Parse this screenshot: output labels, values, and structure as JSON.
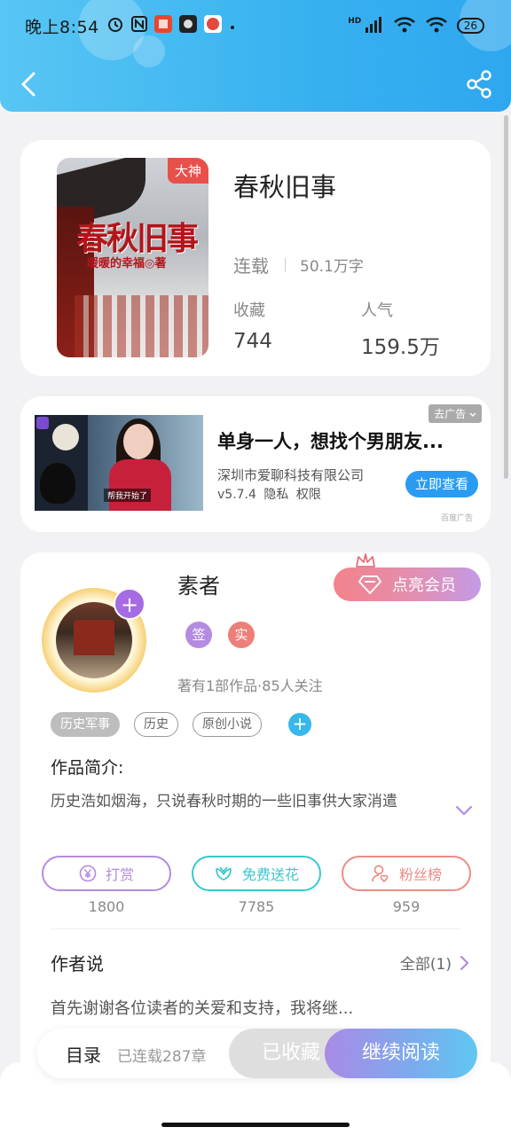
{
  "status_bar": {
    "time": "晚上8:54",
    "network": "HD",
    "battery": "26"
  },
  "book": {
    "title": "春秋旧事",
    "cover_title": "春秋旧事",
    "cover_author": "暖暖的幸福◎著",
    "badge": "大神",
    "status": "连载",
    "word_count": "50.1万字",
    "favorites_label": "收藏",
    "favorites_value": "744",
    "popularity_label": "人气",
    "popularity_value": "159.5万"
  },
  "ad": {
    "close_label": "去广告",
    "image_caption": "帮我开始了",
    "headline": "单身一人，想找个男朋友...",
    "company": "深圳市爱聊科技有限公司",
    "version": "v5.7.4",
    "privacy": "隐私",
    "permission": "权限",
    "cta": "立即查看",
    "source": "百度广告"
  },
  "author": {
    "name": "素者",
    "vip_button": "点亮会员",
    "chip_sign": "签",
    "chip_real": "实",
    "info": "著有1部作品·85人关注",
    "tags": [
      "历史军事",
      "历史",
      "原创小说"
    ],
    "intro_heading": "作品简介:",
    "intro_text": "历史浩如烟海，只说春秋时期的一些旧事供大家消遣",
    "actions": [
      {
        "label": "打赏",
        "count": "1800",
        "color": "#b48be0"
      },
      {
        "label": "免费送花",
        "count": "7785",
        "color": "#3cc7cf"
      },
      {
        "label": "粉丝榜",
        "count": "959",
        "color": "#ec8c86"
      }
    ],
    "talk_heading": "作者说",
    "talk_all": "全部(1)",
    "talk_text": "首先谢谢各位读者的关爱和支持，我将继..."
  },
  "bottom_bar": {
    "toc": "目录",
    "chapters": "已连载287章",
    "saved": "已收藏",
    "read": "继续阅读"
  }
}
